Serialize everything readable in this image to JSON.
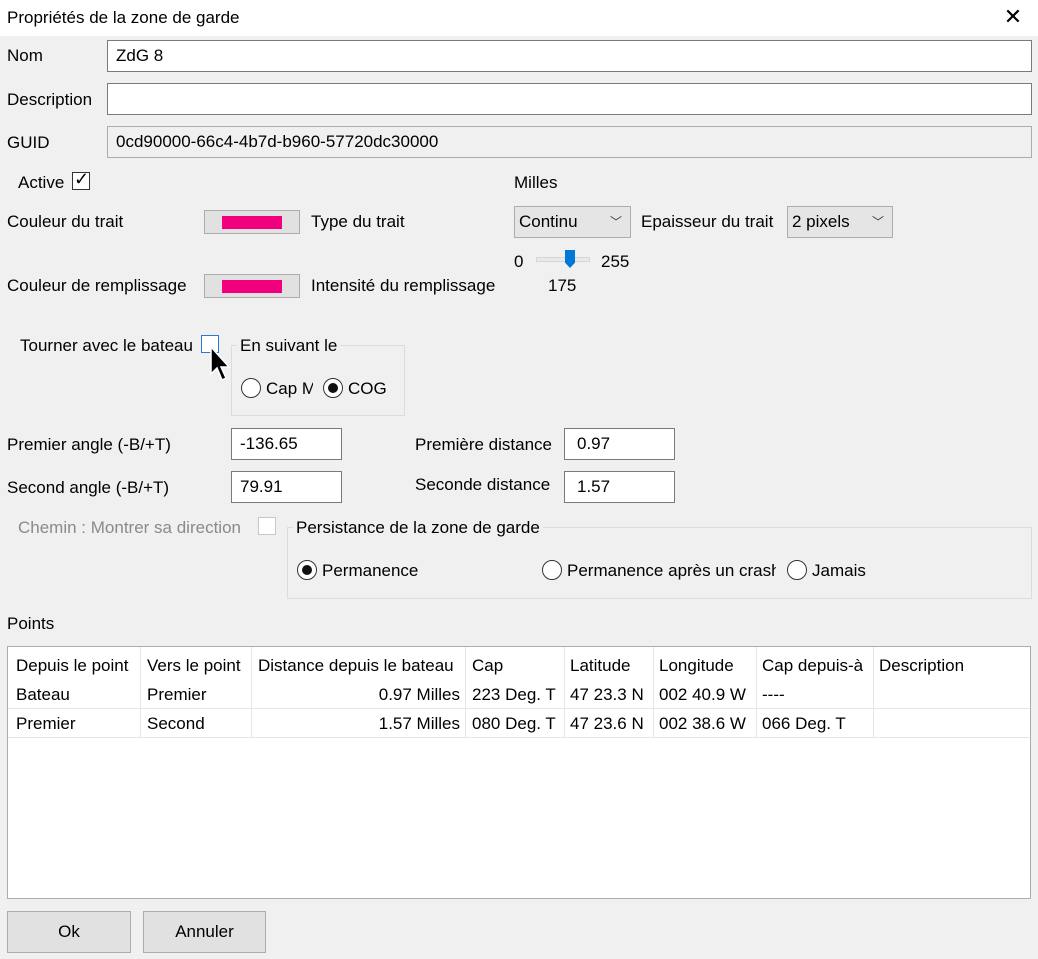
{
  "window": {
    "title": "Propriétés de la zone de garde",
    "close_glyph": "✕"
  },
  "fields": {
    "name_label": "Nom",
    "name_value": "ZdG 8",
    "description_label": "Description",
    "description_value": "",
    "guid_label": "GUID",
    "guid_value": "0cd90000-66c4-4b7d-b960-57720dc30000"
  },
  "active": {
    "label": "Active",
    "checked": true
  },
  "units_label": "Milles",
  "line": {
    "color_label": "Couleur du trait",
    "color": "#f0007f",
    "type_label": "Type du trait",
    "type_value": "Continu",
    "thickness_label": "Epaisseur du trait",
    "thickness_value": "2 pixels"
  },
  "fill": {
    "color_label": "Couleur de remplissage",
    "color": "#f0007f",
    "intensity_label": "Intensité du remplissage",
    "slider_min": "0",
    "slider_max": "255",
    "slider_value": "175"
  },
  "rotate": {
    "label": "Tourner avec le bateau",
    "checked": false,
    "group_title": "En suivant le",
    "option_cap": "Cap M",
    "option_cog": "COG",
    "selected": "COG"
  },
  "angles": {
    "first_label": "Premier angle (-B/+T)",
    "first_value": "-136.65",
    "second_label": "Second angle (-B/+T)",
    "second_value": "79.91"
  },
  "distances": {
    "first_label": "Première distance",
    "first_value": "0.97",
    "second_label": "Seconde distance",
    "second_value": "1.57"
  },
  "path": {
    "label": "Chemin : Montrer sa direction",
    "checked": false
  },
  "persistence": {
    "title": "Persistance de la zone de garde",
    "option_permanent": "Permanence",
    "option_after_crash": "Permanence après un crash",
    "option_never": "Jamais",
    "selected": "Permanence"
  },
  "points": {
    "label": "Points",
    "columns": [
      "Depuis le point",
      "Vers le point",
      "Distance depuis le bateau",
      "Cap",
      "Latitude",
      "Longitude",
      "Cap depuis-à",
      "Description"
    ],
    "rows": [
      [
        "Bateau",
        "Premier",
        "0.97 Milles",
        "223 Deg. T",
        "47 23.3 N",
        "002 40.9 W",
        "----",
        ""
      ],
      [
        "Premier",
        "Second",
        "1.57 Milles",
        "080 Deg. T",
        "47 23.6 N",
        "002 38.6 W",
        "066 Deg. T",
        ""
      ]
    ]
  },
  "buttons": {
    "ok": "Ok",
    "cancel": "Annuler"
  }
}
